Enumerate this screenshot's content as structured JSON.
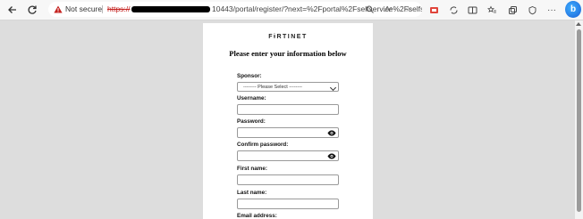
{
  "browser": {
    "security_label": "Not secure",
    "url_scheme": "https://",
    "url_path": "10443/portal/register/?next=%2Fportal%2Fselfservice%2Fselfservic...",
    "icons": [
      "back-icon",
      "refresh-icon",
      "warning-icon",
      "search-icon",
      "read-aloud-icon",
      "favorite-icon",
      "extension-icon",
      "sync-icon",
      "split-screen-icon",
      "favorites-icon",
      "collections-icon",
      "performance-icon",
      "bing-copilot-icon"
    ],
    "bing_label": "b"
  },
  "form": {
    "logo": "FɨRTINET",
    "heading": "Please enter your information below",
    "sponsor_label": "Sponsor:",
    "sponsor_value": "-------- Please Select --------",
    "username_label": "Username:",
    "password_label": "Password:",
    "confirm_password_label": "Confirm password:",
    "first_name_label": "First name:",
    "last_name_label": "Last name:",
    "email_label": "Email address:"
  },
  "colors": {
    "not_secure": "#c5221f",
    "page_bg": "#dddddd",
    "card_bg": "#ffffff"
  }
}
